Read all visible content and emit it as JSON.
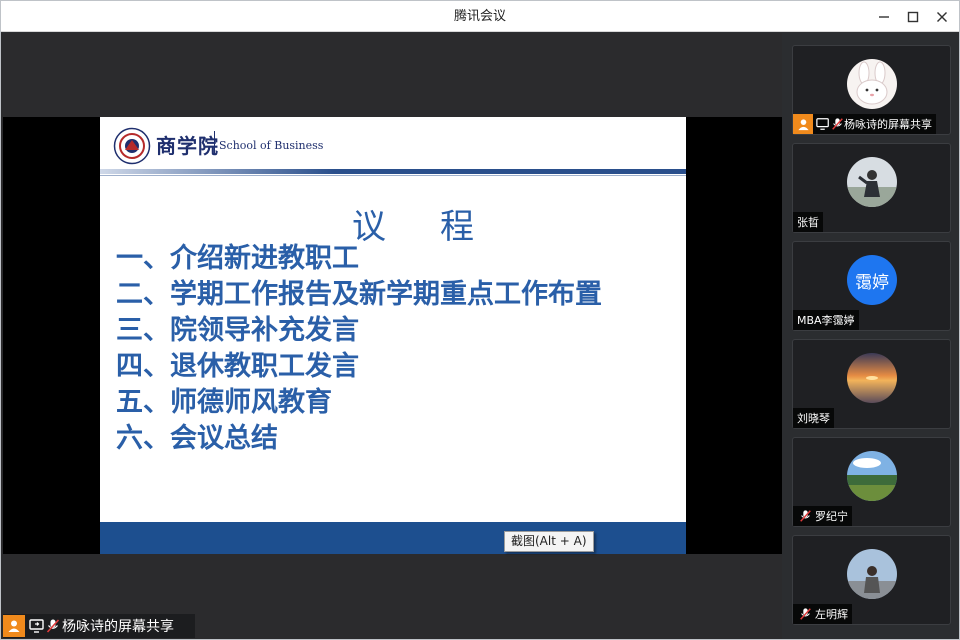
{
  "window": {
    "title": "腾讯会议"
  },
  "slide": {
    "school_cn": "商学院",
    "school_en": "School of Business",
    "title": "议　程",
    "agenda": [
      "一、介绍新进教职工",
      "二、学期工作报告及新学期重点工作布置",
      "三、院领导补充发言",
      "四、退休教职工发言",
      "五、师德师风教育",
      "六、会议总结"
    ]
  },
  "tooltip": "截图(Alt + A)",
  "share_bar": {
    "label": "杨咏诗的屏幕共享"
  },
  "participants": [
    {
      "name": "杨咏诗的屏幕共享",
      "avatar": "rabbit-avatar",
      "sharing": true,
      "muted": true
    },
    {
      "name": "张晢",
      "avatar": "photo-avatar",
      "sharing": false,
      "muted": false
    },
    {
      "name": "MBA李霭婷",
      "avatar": "text-avatar",
      "avatar_text": "霭婷",
      "avatar_color": "#1e76f0",
      "sharing": false,
      "muted": false
    },
    {
      "name": "刘晓琴",
      "avatar": "sunset-photo-avatar",
      "sharing": false,
      "muted": false
    },
    {
      "name": "罗纪宁",
      "avatar": "landscape-photo-avatar",
      "sharing": false,
      "muted": true
    },
    {
      "name": "左明辉",
      "avatar": "photo-avatar",
      "sharing": false,
      "muted": true
    }
  ],
  "colors": {
    "accent_blue": "#2a5fa8",
    "share_orange": "#f08a1c",
    "mute_red": "#e23b3b"
  }
}
